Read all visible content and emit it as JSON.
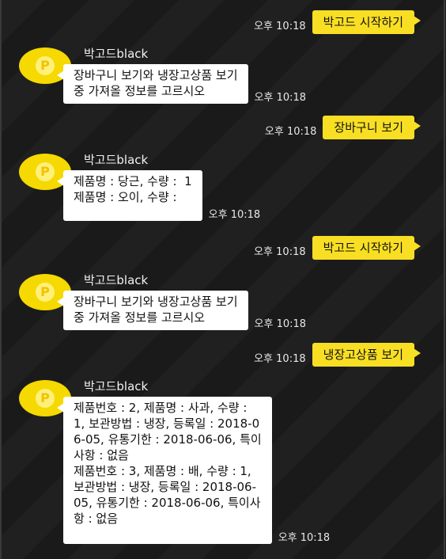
{
  "bot_name": "박고드black",
  "messages": [
    {
      "type": "out",
      "text": "박고드 시작하기",
      "time": "오후 10:18"
    },
    {
      "type": "in",
      "sender": "박고드black",
      "lines": [
        "장바구니 보기와 냉장고상품 보기",
        "중 가져올 정보를 고르시오"
      ],
      "time": "오후 10:18"
    },
    {
      "type": "out",
      "text": "장바구니 보기",
      "time": "오후 10:18"
    },
    {
      "type": "in",
      "sender": "박고드black",
      "lines": [
        "제품명 : 당근, 수량 :  1",
        "제품명 : 오이, 수량 :"
      ],
      "time": "오후 10:18"
    },
    {
      "type": "out",
      "text": "박고드 시작하기",
      "time": "오후 10:18"
    },
    {
      "type": "in",
      "sender": "박고드black",
      "lines": [
        "장바구니 보기와 냉장고상품 보기",
        "중 가져올 정보를 고르시오"
      ],
      "time": "오후 10:18"
    },
    {
      "type": "out",
      "text": "냉장고상품 보기",
      "time": "오후 10:18"
    },
    {
      "type": "in",
      "sender": "박고드black",
      "lines": [
        "제품번호 : 2, 제품명 : 사과, 수량 :",
        "1, 보관방법 : 냉장, 등록일 : 2018-0",
        "6-05, 유통기한 : 2018-06-06, 특이",
        "사항 : 없음",
        "제품번호 : 3, 제품명 : 배, 수량 : 1,",
        "보관방법 : 냉장, 등록일 : 2018-06-",
        "05, 유통기한 : 2018-06-06, 특이사",
        "항 : 없음"
      ],
      "time": "오후 10:18"
    }
  ],
  "colors": {
    "background": "#1b1b1b",
    "outgoing_bubble": "#f9df23",
    "incoming_bubble": "#ffffff",
    "avatar": "#f5d900"
  },
  "icons": {
    "avatar": "coin-p-icon"
  }
}
